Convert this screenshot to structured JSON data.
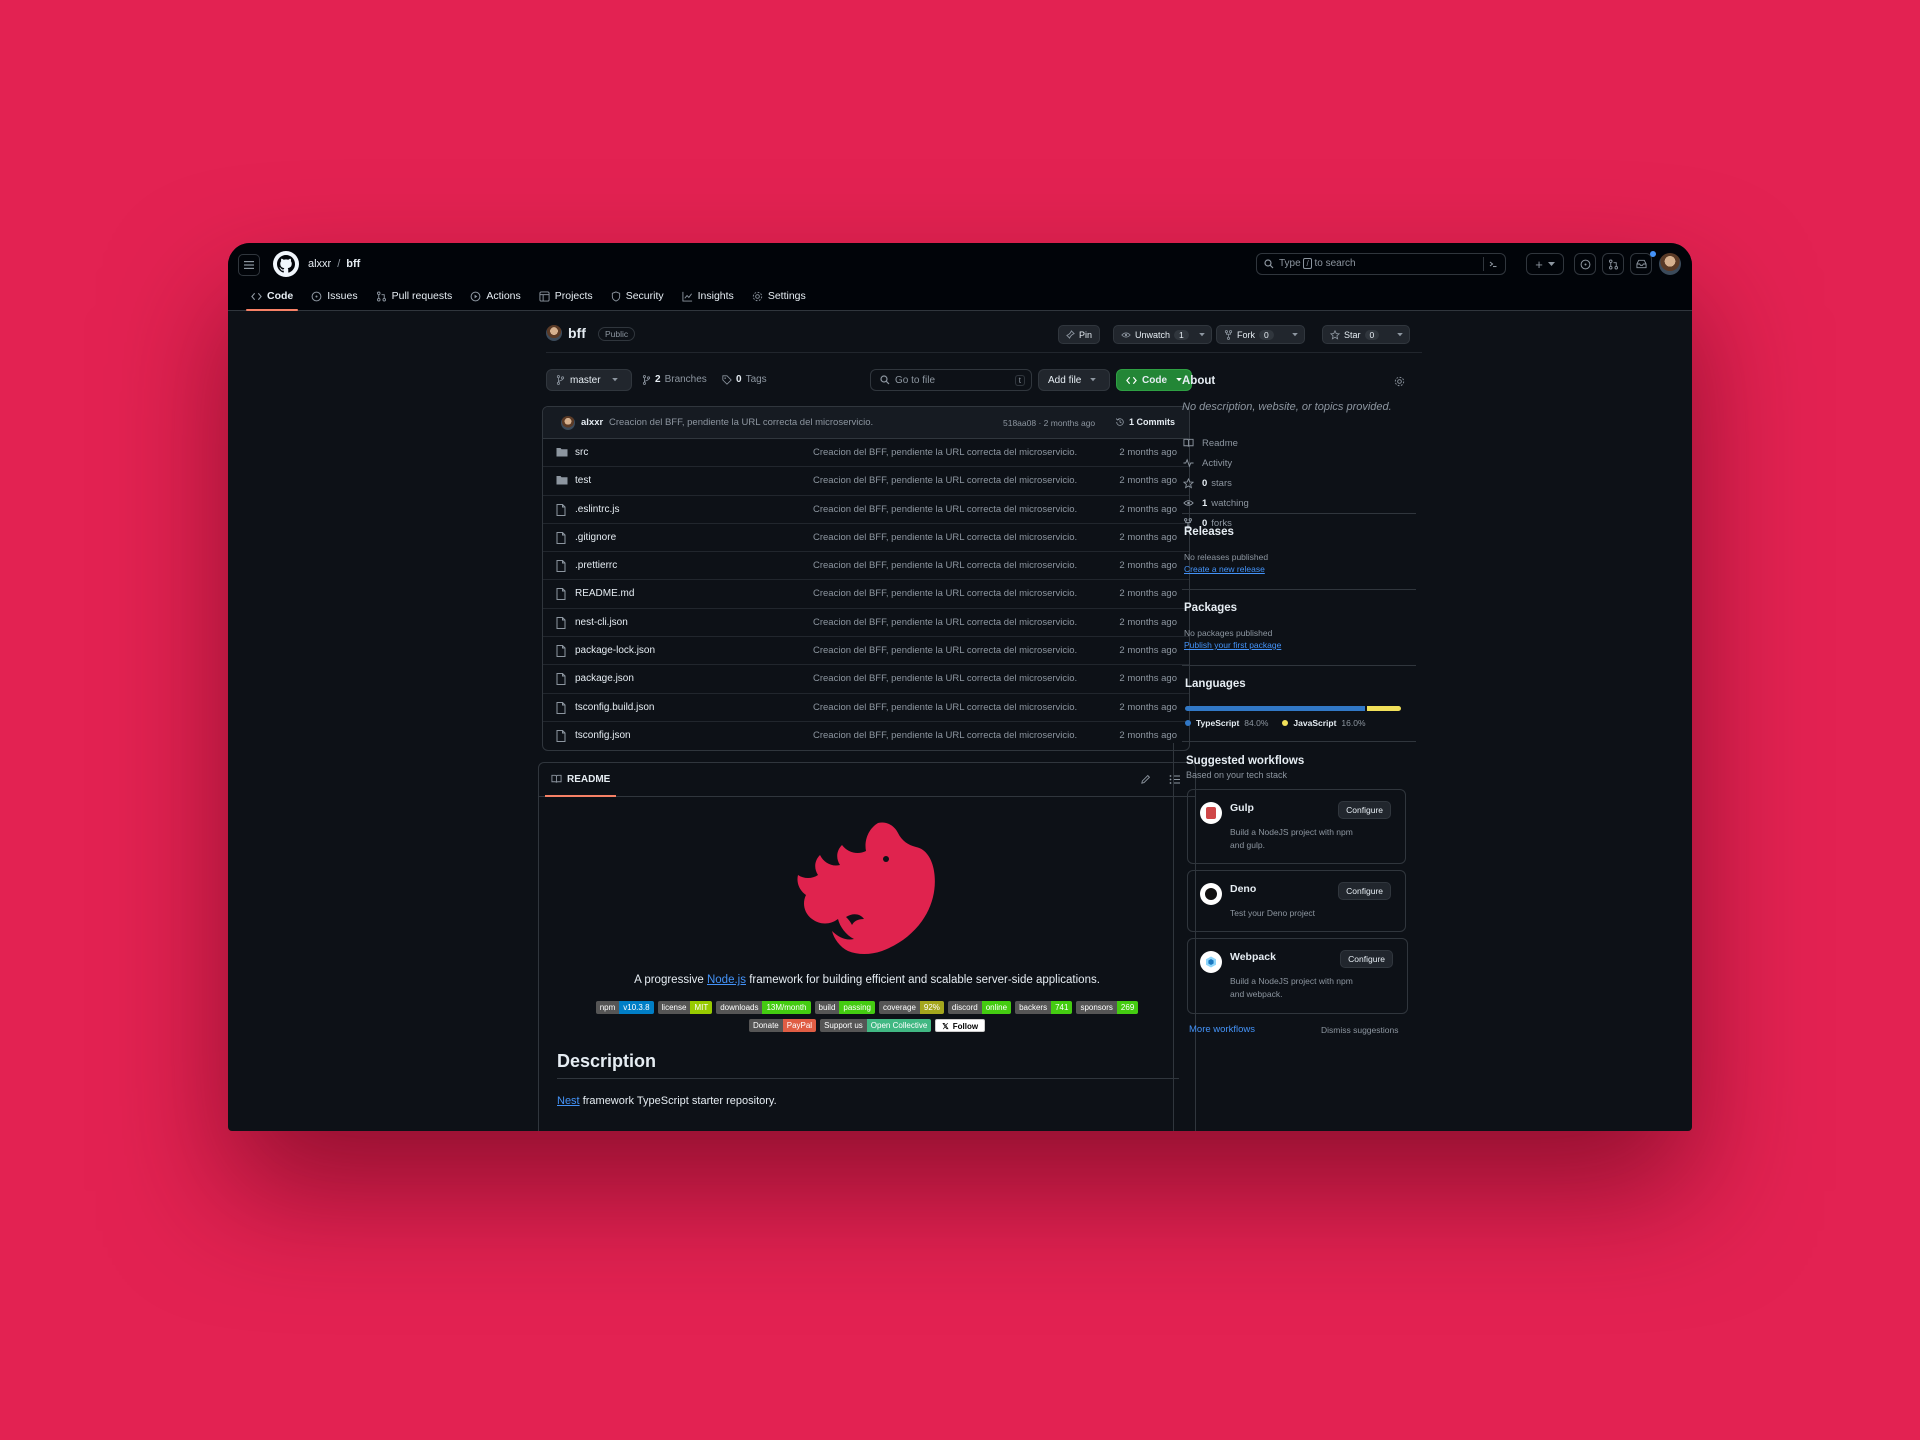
{
  "nav": {
    "owner": "alxxr",
    "separator": "/",
    "repo": "bff",
    "search_placeholder_prefix": "Type",
    "search_key": "/",
    "search_placeholder_suffix": "to search",
    "plus": "+"
  },
  "tabs": [
    {
      "label": "Code"
    },
    {
      "label": "Issues"
    },
    {
      "label": "Pull requests"
    },
    {
      "label": "Actions"
    },
    {
      "label": "Projects"
    },
    {
      "label": "Security"
    },
    {
      "label": "Insights"
    },
    {
      "label": "Settings"
    }
  ],
  "repo": {
    "name": "bff",
    "visibility": "Public",
    "pin": "Pin",
    "unwatch": "Unwatch",
    "watch_count": "1",
    "fork": "Fork",
    "fork_count": "0",
    "star": "Star",
    "star_count": "0"
  },
  "toolbar": {
    "branch": "master",
    "branches_count": "2",
    "branches_label": "Branches",
    "tags_count": "0",
    "tags_label": "Tags",
    "goto_placeholder": "Go to file",
    "goto_key": "t",
    "add_file": "Add file",
    "code": "Code"
  },
  "commit": {
    "author": "alxxr",
    "message": "Creacion del BFF, pendiente la URL correcta del microservicio.",
    "hash_time": "518aa08 · 2 months ago",
    "commits": "1 Commits"
  },
  "files": [
    {
      "name": "src",
      "type": "dir",
      "message": "Creacion del BFF, pendiente la URL correcta del microservicio.",
      "date": "2 months ago"
    },
    {
      "name": "test",
      "type": "dir",
      "message": "Creacion del BFF, pendiente la URL correcta del microservicio.",
      "date": "2 months ago"
    },
    {
      "name": ".eslintrc.js",
      "type": "file",
      "message": "Creacion del BFF, pendiente la URL correcta del microservicio.",
      "date": "2 months ago"
    },
    {
      "name": ".gitignore",
      "type": "file",
      "message": "Creacion del BFF, pendiente la URL correcta del microservicio.",
      "date": "2 months ago"
    },
    {
      "name": ".prettierrc",
      "type": "file",
      "message": "Creacion del BFF, pendiente la URL correcta del microservicio.",
      "date": "2 months ago"
    },
    {
      "name": "README.md",
      "type": "file",
      "message": "Creacion del BFF, pendiente la URL correcta del microservicio.",
      "date": "2 months ago"
    },
    {
      "name": "nest-cli.json",
      "type": "file",
      "message": "Creacion del BFF, pendiente la URL correcta del microservicio.",
      "date": "2 months ago"
    },
    {
      "name": "package-lock.json",
      "type": "file",
      "message": "Creacion del BFF, pendiente la URL correcta del microservicio.",
      "date": "2 months ago"
    },
    {
      "name": "package.json",
      "type": "file",
      "message": "Creacion del BFF, pendiente la URL correcta del microservicio.",
      "date": "2 months ago"
    },
    {
      "name": "tsconfig.build.json",
      "type": "file",
      "message": "Creacion del BFF, pendiente la URL correcta del microservicio.",
      "date": "2 months ago"
    },
    {
      "name": "tsconfig.json",
      "type": "file",
      "message": "Creacion del BFF, pendiente la URL correcta del microservicio.",
      "date": "2 months ago"
    }
  ],
  "readme": {
    "tab": "README",
    "tagline_pre": "A progressive",
    "tagline_link": "Node.js",
    "tagline_post": "framework for building efficient and scalable server-side applications.",
    "badges_row1": [
      {
        "l": "npm",
        "r": "v10.3.8",
        "c": "#007ec6"
      },
      {
        "l": "license",
        "r": "MIT",
        "c": "#97ca00"
      },
      {
        "l": "downloads",
        "r": "13M/month",
        "c": "#4c1"
      },
      {
        "l": "build",
        "r": "passing",
        "c": "#4c1"
      },
      {
        "l": "coverage",
        "r": "92%",
        "c": "#a4a61d"
      },
      {
        "l": "discord",
        "r": "online",
        "c": "#4c1"
      },
      {
        "l": "backers",
        "r": "741",
        "c": "#4c1"
      },
      {
        "l": "sponsors",
        "r": "269",
        "c": "#4c1"
      }
    ],
    "badges_row2": [
      {
        "l": "Donate",
        "r": "PayPal",
        "c": "#e05d44"
      },
      {
        "l": "Support us",
        "r": "Open Collective",
        "c": "#41b883"
      }
    ],
    "follow": "Follow",
    "description_heading": "Description",
    "desc_link": "Nest",
    "desc_text": "framework TypeScript starter repository.",
    "brand_color": "#e0234e"
  },
  "about": {
    "title": "About",
    "description": "No description, website, or topics provided.",
    "items": [
      {
        "icon": "book-icon",
        "label": "Readme",
        "bold": ""
      },
      {
        "icon": "pulse-icon",
        "label": "Activity",
        "bold": ""
      },
      {
        "icon": "star-icon",
        "label": "stars",
        "bold": "0"
      },
      {
        "icon": "eye-icon",
        "label": "watching",
        "bold": "1"
      },
      {
        "icon": "fork-icon",
        "label": "forks",
        "bold": "0"
      }
    ]
  },
  "releases": {
    "title": "Releases",
    "empty": "No releases published",
    "link": "Create a new release"
  },
  "packages": {
    "title": "Packages",
    "empty": "No packages published",
    "link": "Publish your first package"
  },
  "languages": {
    "title": "Languages",
    "items": [
      {
        "name": "TypeScript",
        "pct": "84.0%",
        "value": 84.0,
        "color": "#3178c6"
      },
      {
        "name": "JavaScript",
        "pct": "16.0%",
        "value": 16.0,
        "color": "#f1e05a"
      }
    ]
  },
  "workflows": {
    "title": "Suggested workflows",
    "subtitle": "Based on your tech stack",
    "items": [
      {
        "name": "Gulp",
        "desc": "Build a NodeJS project with npm and gulp.",
        "cfg": "Configure"
      },
      {
        "name": "Deno",
        "desc": "Test your Deno project",
        "cfg": "Configure"
      },
      {
        "name": "Webpack",
        "desc": "Build a NodeJS project with npm and webpack.",
        "cfg": "Configure"
      }
    ],
    "more": "More workflows",
    "dismiss": "Dismiss suggestions"
  }
}
